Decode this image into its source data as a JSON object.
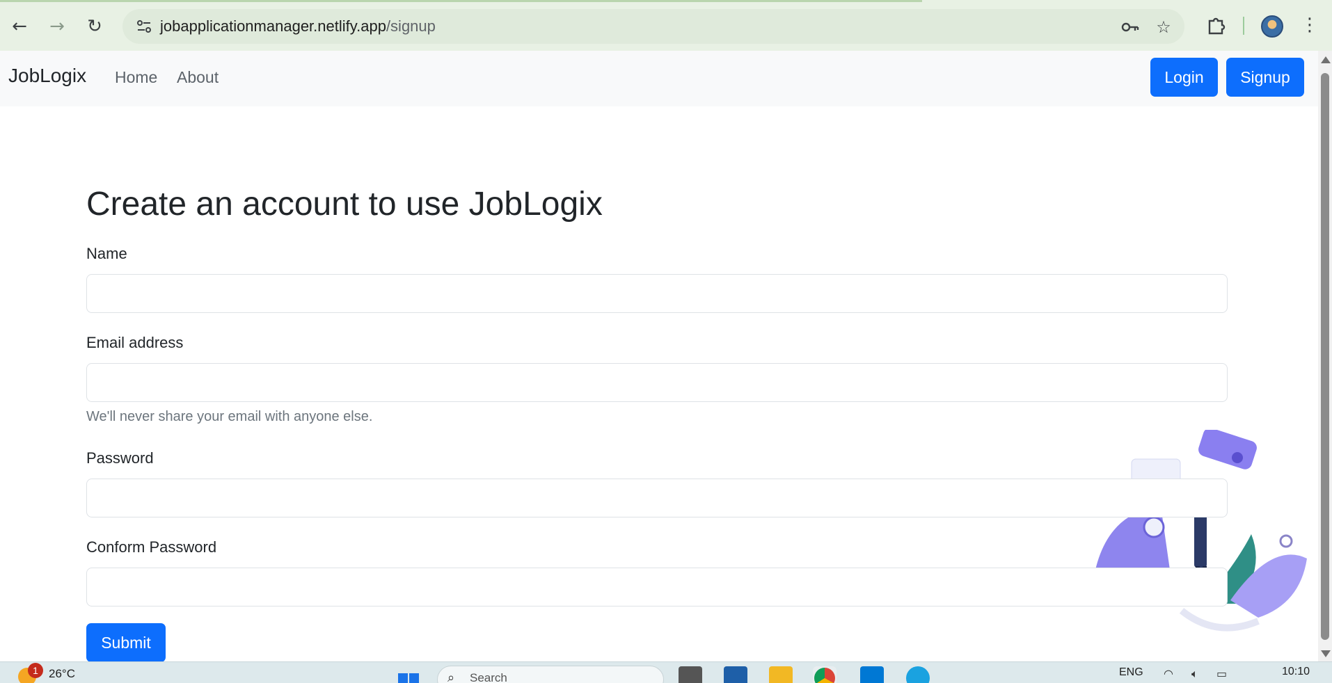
{
  "browser": {
    "url_host": "jobapplicationmanager.netlify.app",
    "url_path": "/signup",
    "back_icon": "arrow-left-icon",
    "forward_icon": "arrow-right-icon",
    "reload_icon": "reload-icon",
    "key_icon": "key-icon",
    "star_icon": "star-icon",
    "extensions_icon": "puzzle-icon",
    "menu_icon": "more-vert-icon"
  },
  "navbar": {
    "brand": "JobLogix",
    "links": [
      {
        "label": "Home"
      },
      {
        "label": "About"
      }
    ],
    "login_label": "Login",
    "signup_label": "Signup"
  },
  "form": {
    "title": "Create an account to use JobLogix",
    "name_label": "Name",
    "email_label": "Email address",
    "email_help": "We'll never share your email with anyone else.",
    "password_label": "Password",
    "confirm_label": "Conform Password",
    "submit_label": "Submit",
    "name_value": "",
    "email_value": "",
    "password_value": "",
    "confirm_value": ""
  },
  "taskbar": {
    "weather_badge": "1",
    "temperature": "26°C",
    "search_placeholder": "Search",
    "language": "ENG",
    "time": "10:10"
  },
  "colors": {
    "primary": "#0d6efd",
    "navbar_bg": "#f8f9fa",
    "chrome_bg": "#e8f1e4"
  }
}
